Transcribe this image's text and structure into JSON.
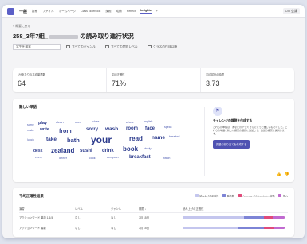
{
  "topbar": {
    "title": "一般",
    "tabs": [
      "投稿",
      "ファイル",
      "ホームページ",
      "Class Notebook",
      "課題",
      "成績",
      "Reflect",
      "Insights",
      "+"
    ],
    "active_tab": "Insights",
    "right_btn": "Ctrl 会議"
  },
  "header": {
    "back": "< 概要に戻る",
    "title_prefix": "258_3年7組_",
    "title_suffix": "の読み取り進行状況"
  },
  "filters": {
    "search_placeholder": "学生を検索",
    "genre": "すべてのジャンル",
    "level": "すべての閲覧レベル",
    "class": "クラスの作成以降"
  },
  "stats": [
    {
      "label": "1分あたりの平均単語数",
      "value": "64"
    },
    {
      "label": "平均正確性",
      "value": "71%"
    },
    {
      "label": "平均試行の時間",
      "value": "3.73"
    }
  ],
  "words_card": {
    "title": "難しい単語",
    "words": [
      "some",
      "play",
      "clean",
      "open",
      "close",
      "where",
      "english",
      "make",
      "write",
      "from",
      "sorry",
      "wash",
      "room",
      "face",
      "speak",
      "lunch",
      "take",
      "bath",
      "your",
      "read",
      "name",
      "baseball",
      "desk",
      "zealand",
      "sushi",
      "drink",
      "book",
      "study",
      "every",
      "dinner",
      "cook",
      "computer",
      "breakfast",
      "watch"
    ],
    "side_title": "チャレンジの課題を作成する",
    "side_desc": "これらの単語は、あなたのクラス さんにとって難しいものでした。これらの単語を新しい練習の課題に追加して、追加の練習を提供します。",
    "side_button": "課題の割り当てを作成する"
  },
  "table_card": {
    "title": "平均正確性結果",
    "legend": [
      {
        "label": "読み上げの正確性",
        "color": "#c4c6ee"
      },
      {
        "label": "発音数",
        "color": "#7d84d6"
      },
      {
        "label": "Accuracy / Mistranslation 省略",
        "color": "#e04a7a"
      },
      {
        "label": "挿入",
        "color": "#c06ad0"
      }
    ],
    "headers": [
      "演習",
      "レベル",
      "ジャンル",
      "期限 ↓",
      "読み上げの正確性"
    ],
    "rows": [
      {
        "name": "アクションワード 単語 1-6.5",
        "level": "なし",
        "genre": "なし",
        "due": "7月 15日",
        "bar": [
          0.6,
          0.2,
          0.08,
          0.12
        ]
      },
      {
        "name": "アクションワード 最新",
        "level": "なし",
        "genre": "なし",
        "due": "7月 15日",
        "bar": [
          0.55,
          0.25,
          0.1,
          0.1
        ]
      }
    ]
  }
}
